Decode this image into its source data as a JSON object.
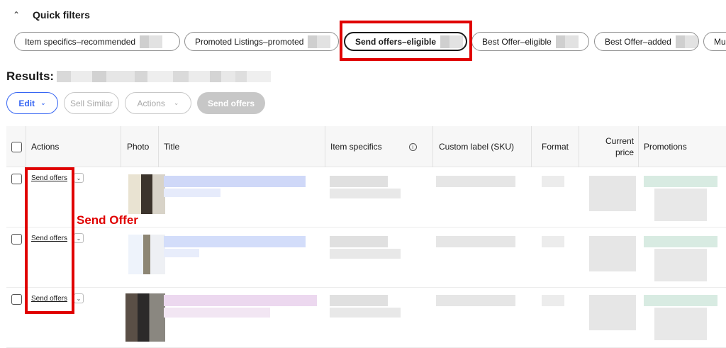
{
  "quick_filters": {
    "title": "Quick filters",
    "chips": [
      {
        "label": "Item specifics–recommended",
        "selected": false
      },
      {
        "label": "Promoted Listings–promoted",
        "selected": false
      },
      {
        "label": "Send offers–eligible",
        "selected": true
      },
      {
        "label": "Best Offer–eligible",
        "selected": false
      },
      {
        "label": "Best Offer–added",
        "selected": false
      },
      {
        "label": "Mul",
        "selected": false
      }
    ]
  },
  "results": {
    "label": "Results:"
  },
  "toolbar": {
    "edit_label": "Edit",
    "sell_similar_label": "Sell Similar",
    "actions_label": "Actions",
    "send_offers_label": "Send offers"
  },
  "table": {
    "headers": {
      "actions": "Actions",
      "photo": "Photo",
      "title": "Title",
      "item_specifics": "Item specifics",
      "custom_label": "Custom label (SKU)",
      "format": "Format",
      "current_price_1": "Current",
      "current_price_2": "price",
      "promotions": "Promotions"
    },
    "rows": [
      {
        "action_label": "Send offers"
      },
      {
        "action_label": "Send offers"
      },
      {
        "action_label": "Send offers"
      }
    ]
  },
  "annotation": {
    "label": "Send Offer",
    "color": "#e00000"
  },
  "colors": {
    "accent": "#3665f3",
    "highlight": "#e00000"
  }
}
